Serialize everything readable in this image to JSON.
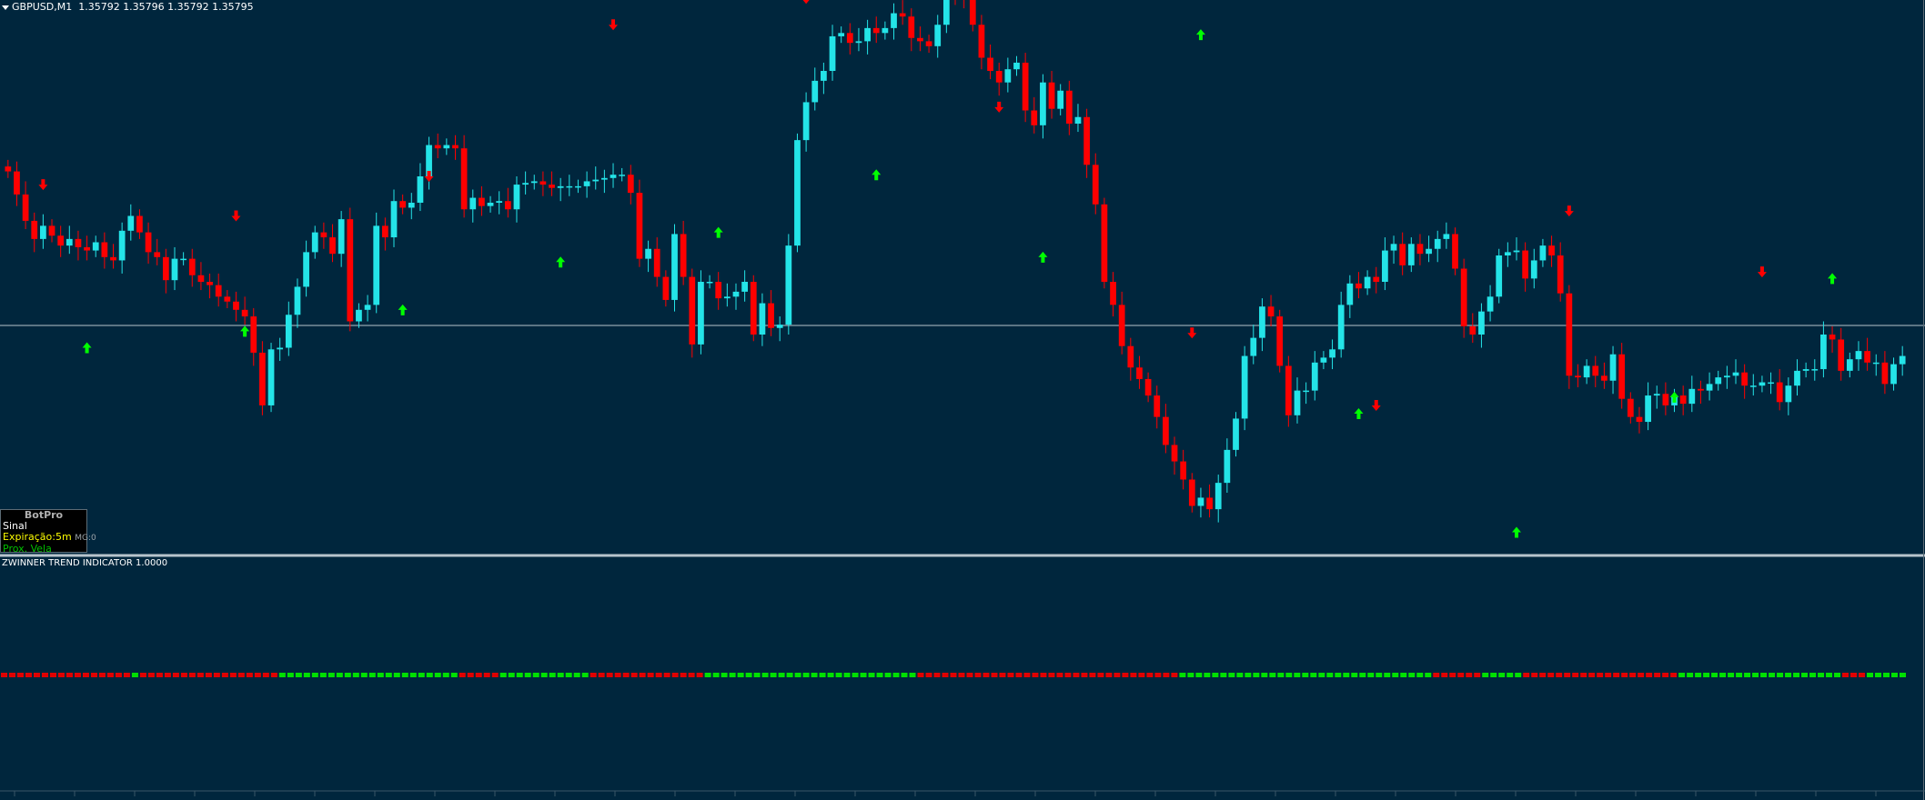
{
  "header": {
    "symbol": "GBPUSD,M1",
    "ohlc": "1.35792 1.35796 1.35792 1.35795"
  },
  "indicator": {
    "title": "ZWINNER TREND INDICATOR 1.0000"
  },
  "botpro": {
    "title": "BotPro",
    "sinal": "Sinal",
    "expiracao": "Expiração:5m",
    "mg": "MG:0",
    "prox": "Prox. Vela"
  },
  "colors": {
    "background": "#00263d",
    "bull_candle": "#24e4e8",
    "bear_candle": "#ff0000",
    "up_arrow": "#00ff00",
    "down_arrow": "#ff0000",
    "price_line": "#b8c4cc",
    "separator": "#b8c4cc"
  },
  "chart_data": {
    "type": "candlestick",
    "symbol": "GBPUSD",
    "timeframe": "M1",
    "current_price": 1.35795,
    "y_range": [
      1.3568,
      1.36
    ],
    "candles": [
      1.35907,
      1.35893,
      1.35877,
      1.35866,
      1.35874,
      1.35868,
      1.35862,
      1.35866,
      1.35861,
      1.35859,
      1.35864,
      1.35855,
      1.35853,
      1.35871,
      1.3588,
      1.3587,
      1.35858,
      1.35855,
      1.35841,
      1.35854,
      1.35854,
      1.35844,
      1.3584,
      1.35838,
      1.35831,
      1.35828,
      1.35823,
      1.35819,
      1.35797,
      1.35765,
      1.35799,
      1.358,
      1.3582,
      1.35837,
      1.35858,
      1.3587,
      1.35867,
      1.35857,
      1.35878,
      1.35816,
      1.35823,
      1.35826,
      1.35874,
      1.35867,
      1.35889,
      1.35885,
      1.35888,
      1.35904,
      1.35923,
      1.35921,
      1.35923,
      1.35921,
      1.35884,
      1.35891,
      1.35886,
      1.35888,
      1.35889,
      1.35884,
      1.35899,
      1.359,
      1.35901,
      1.35899,
      1.35897,
      1.35898,
      1.35898,
      1.35898,
      1.35901,
      1.35902,
      1.35903,
      1.35905,
      1.35905,
      1.35894,
      1.35854,
      1.3586,
      1.35843,
      1.35829,
      1.35869,
      1.35843,
      1.35802,
      1.3584,
      1.3584,
      1.3583,
      1.35831,
      1.35834,
      1.3584,
      1.35808,
      1.35827,
      1.35812,
      1.35814,
      1.35862,
      1.35926,
      1.35949,
      1.35962,
      1.35968,
      1.35989,
      1.35991,
      1.35985,
      1.35986,
      1.35994,
      1.35991,
      1.35994,
      1.36003,
      1.36001,
      1.35988,
      1.35986,
      1.35983,
      1.35996,
      1.36018,
      1.36016,
      1.36012,
      1.35996,
      1.35976,
      1.35968,
      1.35961,
      1.35969,
      1.35973,
      1.35944,
      1.35935,
      1.35961,
      1.35945,
      1.35956,
      1.35936,
      1.3594,
      1.35911,
      1.35887,
      1.3584,
      1.35826,
      1.35801,
      1.35788,
      1.35781,
      1.35771,
      1.35758,
      1.35741,
      1.35731,
      1.3572,
      1.35704,
      1.35709,
      1.35702,
      1.35718,
      1.35738,
      1.35757,
      1.35795,
      1.35806,
      1.35825,
      1.35819,
      1.35789,
      1.35759,
      1.35774,
      1.35774,
      1.35791,
      1.35794,
      1.35799,
      1.35826,
      1.35839,
      1.35836,
      1.35843,
      1.3584,
      1.35859,
      1.35863,
      1.3585,
      1.35863,
      1.35857,
      1.3586,
      1.35866,
      1.35869,
      1.35848,
      1.35813,
      1.35808,
      1.35822,
      1.35831,
      1.35856,
      1.35858,
      1.35859,
      1.35842,
      1.35853,
      1.35862,
      1.35856,
      1.35833,
      1.35783,
      1.35782,
      1.35789,
      1.35783,
      1.3578,
      1.35796,
      1.35769,
      1.35758,
      1.35755,
      1.35771,
      1.35772,
      1.35765,
      1.35771,
      1.35766,
      1.35775,
      1.35774,
      1.35778,
      1.35782,
      1.35783,
      1.35785,
      1.35777,
      1.35777,
      1.35779,
      1.35779,
      1.35767,
      1.35777,
      1.35786,
      1.35787,
      1.35787,
      1.35808,
      1.35805,
      1.35786,
      1.35793,
      1.35798,
      1.35791,
      1.35791,
      1.35778,
      1.3579,
      1.35795
    ],
    "signal_arrows": {
      "up": [
        1.358,
        1.3581,
        1.35823,
        1.35852,
        1.3587,
        1.35905,
        1.35855,
        1.3599,
        1.3576,
        1.35688,
        1.3577,
        1.35842
      ],
      "down": [
        1.35899,
        1.3588,
        1.35904,
        1.35996,
        1.36012,
        1.35946,
        1.35809,
        1.35765,
        1.35883,
        1.35846
      ]
    },
    "indicator": {
      "name": "ZWINNER TREND INDICATOR",
      "value": 1.0,
      "segments": [
        {
          "color": "red",
          "count": 16
        },
        {
          "color": "green",
          "count": 1
        },
        {
          "color": "red",
          "count": 17
        },
        {
          "color": "green",
          "count": 22
        },
        {
          "color": "red",
          "count": 5
        },
        {
          "color": "green",
          "count": 11
        },
        {
          "color": "red",
          "count": 14
        },
        {
          "color": "green",
          "count": 26
        },
        {
          "color": "red",
          "count": 32
        },
        {
          "color": "green",
          "count": 31
        },
        {
          "color": "red",
          "count": 6
        },
        {
          "color": "green",
          "count": 5
        },
        {
          "color": "red",
          "count": 19
        },
        {
          "color": "green",
          "count": 20
        },
        {
          "color": "red",
          "count": 3
        },
        {
          "color": "green",
          "count": 5
        }
      ]
    }
  }
}
